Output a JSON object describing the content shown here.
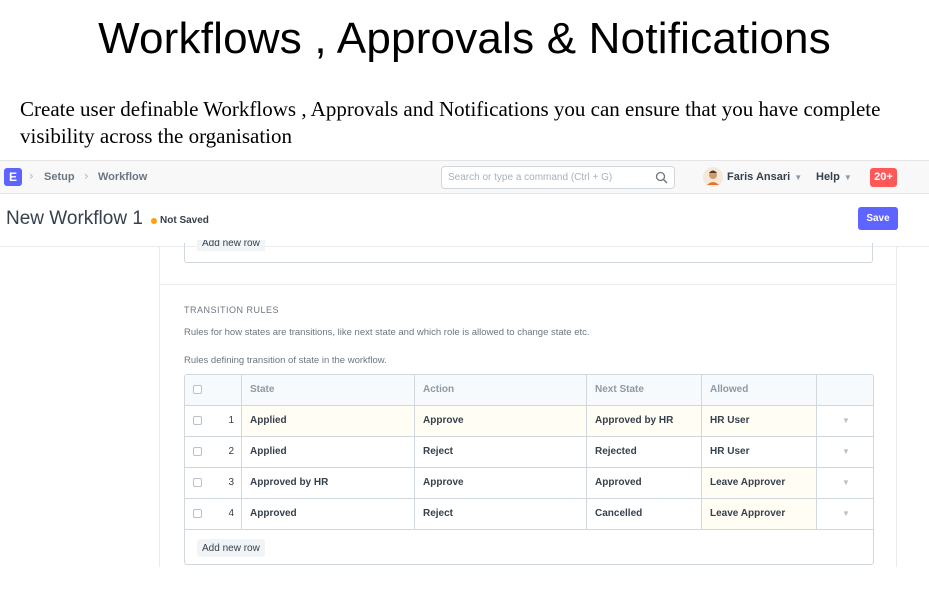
{
  "slide": {
    "title": "Workflows , Approvals & Notifications",
    "description": "Create user definable Workflows , Approvals and Notifications  you can ensure that you have complete visibility across the organisation"
  },
  "navbar": {
    "logo_letter": "E",
    "breadcrumbs": [
      "Setup",
      "Workflow"
    ],
    "search_placeholder": "Search or type a command (Ctrl + G)",
    "user_name": "Faris Ansari",
    "help_label": "Help",
    "notification_count": "20+",
    "accent_color": "#5e64ff",
    "notification_color": "#ff5858"
  },
  "page_head": {
    "title": "New Workflow 1",
    "status": "Not Saved",
    "save_label": "Save"
  },
  "form": {
    "previous_add_row_label": "Add new row",
    "section_title": "TRANSITION RULES",
    "section_description": "Rules for how states are transitions, like next state and which role is allowed to change state etc.",
    "field_description": "Rules defining transition of state in the workflow.",
    "table": {
      "columns": [
        "State",
        "Action",
        "Next State",
        "Allowed"
      ],
      "rows": [
        {
          "idx": "1",
          "state": "Applied",
          "action": "Approve",
          "next_state": "Approved by HR",
          "allowed": "HR User"
        },
        {
          "idx": "2",
          "state": "Applied",
          "action": "Reject",
          "next_state": "Rejected",
          "allowed": "HR User"
        },
        {
          "idx": "3",
          "state": "Approved by HR",
          "action": "Approve",
          "next_state": "Approved",
          "allowed": "Leave Approver"
        },
        {
          "idx": "4",
          "state": "Approved",
          "action": "Reject",
          "next_state": "Cancelled",
          "allowed": "Leave Approver"
        }
      ]
    },
    "add_row_label": "Add new row"
  }
}
